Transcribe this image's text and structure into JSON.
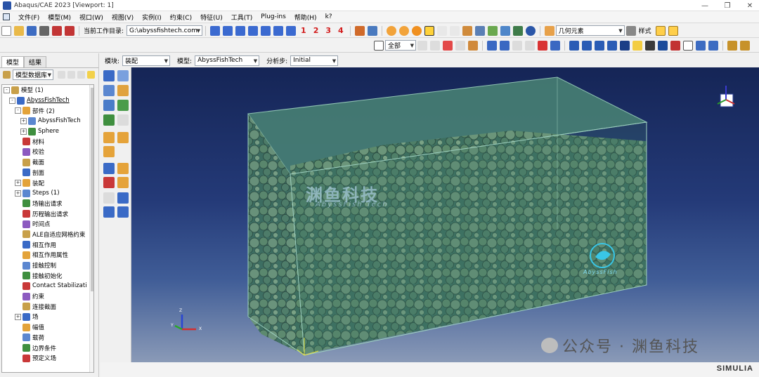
{
  "window": {
    "title": "Abaqus/CAE 2023 [Viewport: 1]",
    "controls": [
      "—",
      "❐",
      "✕"
    ]
  },
  "menu": {
    "items": [
      "文件(F)",
      "模型(M)",
      "视口(W)",
      "视图(V)",
      "实例(I)",
      "约束(C)",
      "特征(U)",
      "工具(T)",
      "Plug-ins",
      "帮助(H)",
      "k?"
    ]
  },
  "toolbar": {
    "workdir_label": "当前工作目录:",
    "workdir_value": "G:\\abyssfishtech.com",
    "view_numbers": [
      "1",
      "2",
      "3",
      "4"
    ],
    "geometry_filter": "几何元素",
    "style_label": "样式",
    "selection_filter": "全部"
  },
  "context": {
    "module_label": "模块:",
    "module_value": "装配",
    "model_label": "模型:",
    "model_value": "AbyssFishTech",
    "step_label": "分析步:",
    "step_value": "Initial"
  },
  "left_panel": {
    "tabs": [
      "模型",
      "结果"
    ],
    "tree_selector": "模型数据库",
    "tree": [
      {
        "label": "模型 (1)",
        "level": 0,
        "exp": "-"
      },
      {
        "label": "AbyssFishTech",
        "level": 1,
        "exp": "-"
      },
      {
        "label": "部件 (2)",
        "level": 2,
        "exp": "-"
      },
      {
        "label": "AbyssFishTech",
        "level": 3,
        "exp": "+"
      },
      {
        "label": "Sphere",
        "level": 3,
        "exp": "+"
      },
      {
        "label": "材料",
        "level": 2,
        "exp": ""
      },
      {
        "label": "校验",
        "level": 2,
        "exp": ""
      },
      {
        "label": "截面",
        "level": 2,
        "exp": ""
      },
      {
        "label": "剖面",
        "level": 2,
        "exp": ""
      },
      {
        "label": "装配",
        "level": 2,
        "exp": "+"
      },
      {
        "label": "Steps (1)",
        "level": 2,
        "exp": "+"
      },
      {
        "label": "场输出请求",
        "level": 2,
        "exp": ""
      },
      {
        "label": "历程输出请求",
        "level": 2,
        "exp": ""
      },
      {
        "label": "时间点",
        "level": 2,
        "exp": ""
      },
      {
        "label": "ALE自适应网格约束",
        "level": 2,
        "exp": ""
      },
      {
        "label": "相互作用",
        "level": 2,
        "exp": ""
      },
      {
        "label": "相互作用属性",
        "level": 2,
        "exp": ""
      },
      {
        "label": "接触控制",
        "level": 2,
        "exp": ""
      },
      {
        "label": "接触初始化",
        "level": 2,
        "exp": ""
      },
      {
        "label": "Contact Stabilizati",
        "level": 2,
        "exp": ""
      },
      {
        "label": "约束",
        "level": 2,
        "exp": ""
      },
      {
        "label": "连接截面",
        "level": 2,
        "exp": ""
      },
      {
        "label": "场",
        "level": 2,
        "exp": "+"
      },
      {
        "label": "幅值",
        "level": 2,
        "exp": ""
      },
      {
        "label": "载荷",
        "level": 2,
        "exp": ""
      },
      {
        "label": "边界条件",
        "level": 2,
        "exp": ""
      },
      {
        "label": "预定义场",
        "level": 2,
        "exp": ""
      }
    ]
  },
  "viewport": {
    "watermark_cn": "渊鱼科技",
    "watermark_en": "AbyssFish Tech",
    "logo_text": "AbyssFish",
    "triad_labels": [
      "Z",
      "Y",
      "X"
    ]
  },
  "footer": {
    "brand": "SIMULIA",
    "wechat_watermark": "公众号 · 渊鱼科技"
  },
  "colors": {
    "viewport_top": "#152556",
    "viewport_bottom": "#8a9ab7",
    "box_face": "#3f7a6a",
    "accent_red": "#d21c1c"
  }
}
